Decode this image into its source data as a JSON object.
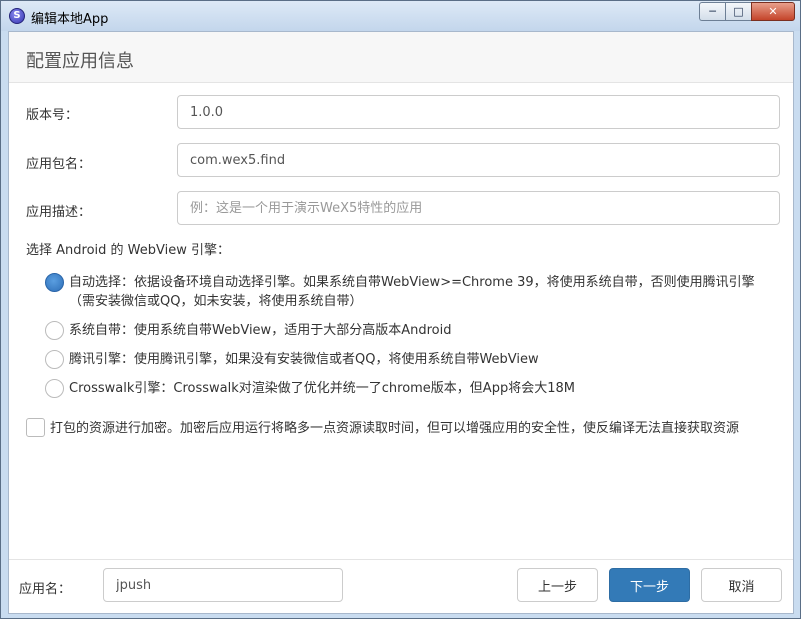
{
  "window": {
    "title": "编辑本地App",
    "icon_letter": "S",
    "controls": {
      "minimize": "─",
      "maximize": "□",
      "close": "✕"
    }
  },
  "header": {
    "title": "配置应用信息"
  },
  "form": {
    "version": {
      "label": "版本号：",
      "value": "1.0.0"
    },
    "package": {
      "label": "应用包名：",
      "value": "com.wex5.find"
    },
    "description": {
      "label": "应用描述：",
      "value": "",
      "placeholder": "例：这是一个用于演示WeX5特性的应用"
    }
  },
  "webview": {
    "label": "选择 Android 的 WebView 引擎：",
    "selected": 0,
    "options": [
      {
        "label": "自动选择：依据设备环境自动选择引擎。如果系统自带WebView>=Chrome 39，将使用系统自带，否则使用腾讯引擎（需安装微信或QQ，如未安装，将使用系统自带）"
      },
      {
        "label": "系统自带：使用系统自带WebView，适用于大部分高版本Android"
      },
      {
        "label": "腾讯引擎：使用腾讯引擎，如果没有安装微信或者QQ，将使用系统自带WebView"
      },
      {
        "label": "Crosswalk引擎：Crosswalk对渲染做了优化并统一了chrome版本，但App将会大18M"
      }
    ]
  },
  "encrypt": {
    "label": "打包的资源进行加密。加密后应用运行将略多一点资源读取时间，但可以增强应用的安全性，使反编译无法直接获取资源",
    "checked": false
  },
  "footer": {
    "app_name_label": "应用名：",
    "app_name_value": "jpush",
    "prev_label": "上一步",
    "next_label": "下一步",
    "cancel_label": "取消"
  },
  "colors": {
    "primary": "#337ab7",
    "radio_checked": "#2e6fb8"
  }
}
